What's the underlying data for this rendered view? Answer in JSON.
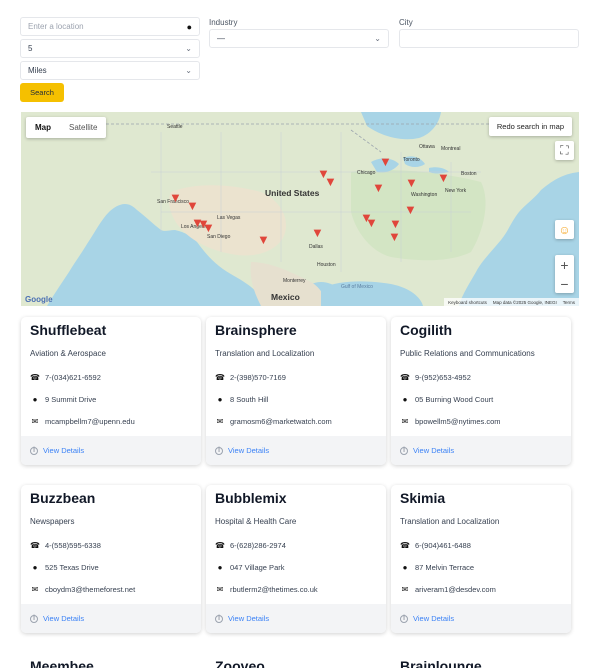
{
  "filters": {
    "location_placeholder": "Enter a location",
    "distance_value": "5",
    "units_value": "Miles",
    "industry_label": "Industry",
    "industry_value": "—",
    "city_label": "City",
    "city_value": "",
    "search_label": "Search"
  },
  "map": {
    "type_map": "Map",
    "type_satellite": "Satellite",
    "redo_label": "Redo search in map",
    "attribution_shortcuts": "Keyboard shortcuts",
    "attribution_data": "Map data ©2025 Google, INEGI",
    "attribution_terms": "Terms",
    "logo": "Google",
    "labels": {
      "us": "United States",
      "mexico": "Mexico",
      "san_francisco": "San Francisco",
      "las_vegas": "Las Vegas",
      "los_angeles": "Los Angeles",
      "san_diego": "San Diego",
      "chicago": "Chicago",
      "toronto": "Toronto",
      "boston": "Boston",
      "new_york": "New York",
      "washington": "Washington",
      "dallas": "Dallas",
      "houston": "Houston",
      "monterrey": "Monterrey",
      "gulf": "Gulf of Mexico",
      "ottawa": "Ottawa",
      "seattle": "Seattle",
      "montreal": "Montreal"
    }
  },
  "companies": [
    {
      "name": "Shufflebeat",
      "industry": "Aviation & Aerospace",
      "phone": "7-(034)621-6592",
      "address": "9 Summit Drive",
      "email": "mcampbellm7@upenn.edu",
      "details": "View Details"
    },
    {
      "name": "Brainsphere",
      "industry": "Translation and Localization",
      "phone": "2-(398)570-7169",
      "address": "8 South Hill",
      "email": "gramosm6@marketwatch.com",
      "details": "View Details"
    },
    {
      "name": "Cogilith",
      "industry": "Public Relations and Communications",
      "phone": "9-(952)653-4952",
      "address": "05 Burning Wood Court",
      "email": "bpowellm5@nytimes.com",
      "details": "View Details"
    },
    {
      "name": "Buzzbean",
      "industry": "Newspapers",
      "phone": "4-(558)595-6338",
      "address": "525 Texas Drive",
      "email": "cboydm3@themeforest.net",
      "details": "View Details"
    },
    {
      "name": "Bubblemix",
      "industry": "Hospital & Health Care",
      "phone": "6-(628)286-2974",
      "address": "047 Village Park",
      "email": "rbutlerm2@thetimes.co.uk",
      "details": "View Details"
    },
    {
      "name": "Skimia",
      "industry": "Translation and Localization",
      "phone": "6-(904)461-6488",
      "address": "87 Melvin Terrace",
      "email": "ariveram1@desdev.com",
      "details": "View Details"
    }
  ],
  "peek": [
    "Meembee",
    "Zooveo",
    "Brainlounge"
  ]
}
